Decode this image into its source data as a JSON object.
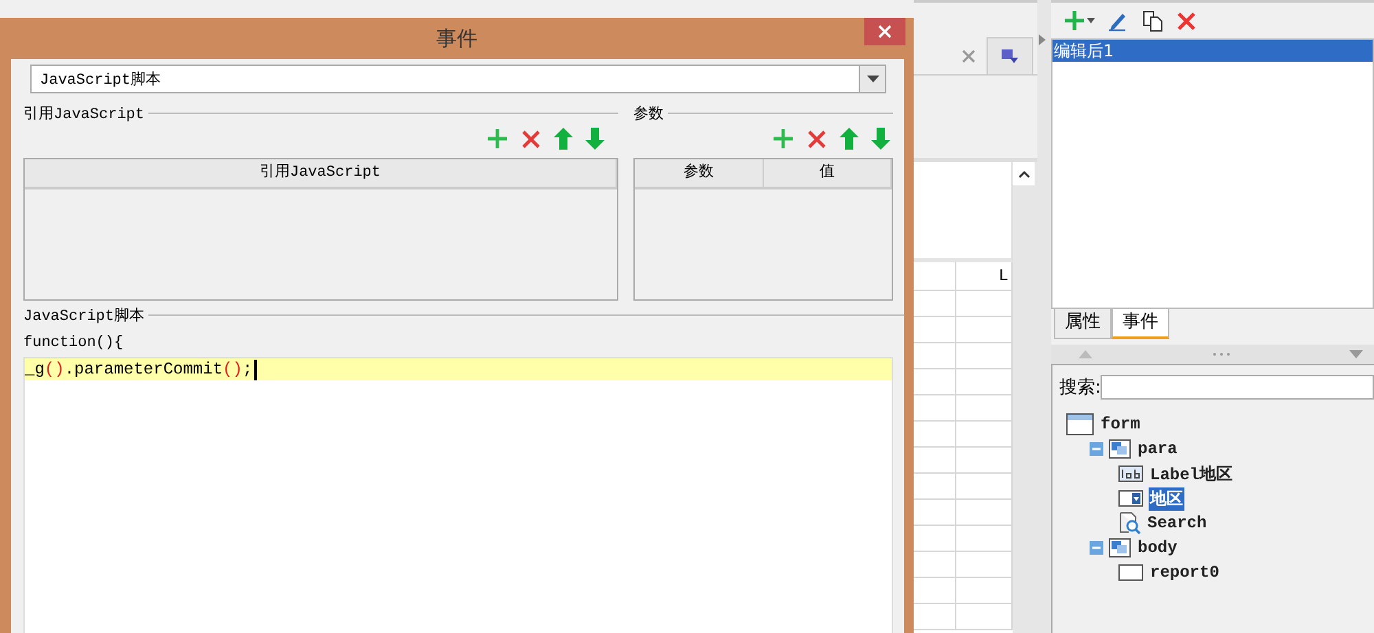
{
  "dialog": {
    "title": "事件",
    "script_type": "JavaScript脚本",
    "referenced_js": {
      "title": "引用JavaScript",
      "columns": [
        "引用JavaScript"
      ]
    },
    "parameters": {
      "title": "参数",
      "columns": [
        "参数",
        "值"
      ]
    },
    "script": {
      "title": "JavaScript脚本",
      "header": "function(){",
      "lines": [
        "_g().parameterCommit();"
      ]
    }
  },
  "grid": {
    "header": "L"
  },
  "event_list": {
    "items": [
      {
        "label": "编辑后1",
        "selected": true
      }
    ]
  },
  "panel_tabs": [
    {
      "label": "属性",
      "selected": false
    },
    {
      "label": "事件",
      "selected": true
    }
  ],
  "search": {
    "label": "搜索:"
  },
  "tree": [
    {
      "label": "form",
      "kind": "form",
      "selected": false,
      "children": [
        {
          "label": "para",
          "kind": "panel",
          "selected": false,
          "expanded": true,
          "children": [
            {
              "label": "Label地区",
              "kind": "label",
              "selected": false
            },
            {
              "label": "地区",
              "kind": "combo",
              "selected": true
            },
            {
              "label": "Search",
              "kind": "search",
              "selected": false
            }
          ]
        },
        {
          "label": "body",
          "kind": "panel",
          "selected": false,
          "expanded": true,
          "children": [
            {
              "label": "report0",
              "kind": "report",
              "selected": false
            }
          ]
        }
      ]
    }
  ]
}
